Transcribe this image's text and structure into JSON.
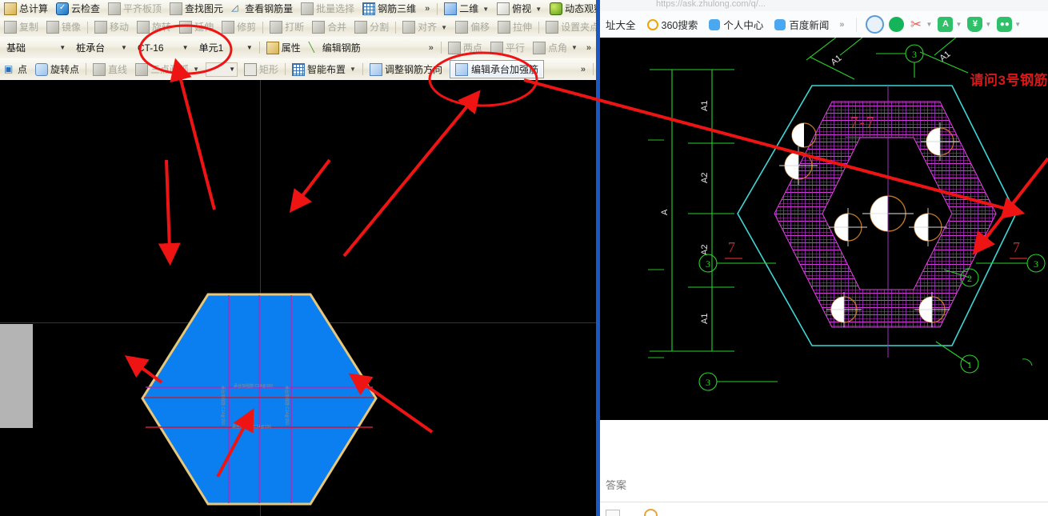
{
  "cad": {
    "toolbar_row1": [
      {
        "label": "总计算",
        "icon": "calc-icon",
        "disabled": false,
        "partial": true
      },
      {
        "label": "云检查",
        "icon": "cloud-check-icon",
        "disabled": false
      },
      {
        "label": "平齐板顶",
        "icon": "align-slab-top-icon",
        "disabled": true
      },
      {
        "label": "查找图元",
        "icon": "binoculars-icon",
        "disabled": false
      },
      {
        "label": "查看钢筋量",
        "icon": "rebar-quantity-icon",
        "disabled": false
      },
      {
        "label": "批量选择",
        "icon": "batch-select-icon",
        "disabled": true
      },
      {
        "label": "钢筋三维",
        "icon": "rebar-3d-icon",
        "disabled": false
      }
    ],
    "toolbar_row1_right": [
      {
        "label": "二维",
        "icon": "2d-view-icon",
        "caret": true
      },
      {
        "label": "俯视",
        "icon": "top-view-icon",
        "caret": true
      },
      {
        "label": "动态观察",
        "icon": "orbit-icon",
        "caret": false
      }
    ],
    "toolbar_row2": [
      {
        "label": "复制",
        "icon": "copy-icon",
        "disabled": true
      },
      {
        "label": "镜像",
        "icon": "mirror-icon",
        "disabled": true
      },
      {
        "label": "移动",
        "icon": "move-icon",
        "disabled": true
      },
      {
        "label": "旋转",
        "icon": "rotate-icon",
        "disabled": true
      },
      {
        "label": "延伸",
        "icon": "extend-icon",
        "disabled": true
      },
      {
        "label": "修剪",
        "icon": "trim-icon",
        "disabled": true
      },
      {
        "label": "打断",
        "icon": "break-icon",
        "disabled": true
      },
      {
        "label": "合并",
        "icon": "merge-icon",
        "disabled": true
      },
      {
        "label": "分割",
        "icon": "split-icon",
        "disabled": true
      },
      {
        "label": "对齐",
        "icon": "align-icon",
        "disabled": true,
        "caret": true
      },
      {
        "label": "偏移",
        "icon": "offset-icon",
        "disabled": true
      },
      {
        "label": "拉伸",
        "icon": "stretch-icon",
        "disabled": true
      },
      {
        "label": "设置夹点",
        "icon": "set-grip-icon",
        "disabled": true
      }
    ],
    "toolbar_row3": {
      "combos": [
        {
          "name": "category",
          "value": "基础"
        },
        {
          "name": "component-type",
          "value": "桩承台"
        },
        {
          "name": "component-code",
          "value": "CT-16"
        },
        {
          "name": "unit",
          "value": "单元1"
        }
      ],
      "buttons": [
        {
          "label": "属性",
          "icon": "properties-icon"
        },
        {
          "label": "编辑钢筋",
          "icon": "edit-rebar-icon"
        }
      ],
      "right_items": [
        {
          "label": "两点",
          "icon": "two-point-icon",
          "disabled": true
        },
        {
          "label": "平行",
          "icon": "parallel-icon",
          "disabled": true
        },
        {
          "label": "点角",
          "icon": "point-angle-icon",
          "disabled": true,
          "caret": true
        }
      ]
    },
    "toolbar_row4": [
      {
        "label": "点",
        "icon": "point-icon",
        "disabled": false
      },
      {
        "label": "旋转点",
        "icon": "rotate-point-icon",
        "disabled": false
      },
      {
        "label": "直线",
        "icon": "line-icon",
        "disabled": true
      },
      {
        "label": "三点画弧",
        "icon": "three-point-arc-icon",
        "disabled": true,
        "caret": true
      },
      {
        "label": "矩形",
        "icon": "rectangle-icon",
        "disabled": true
      },
      {
        "label": "智能布置",
        "icon": "smart-layout-icon",
        "disabled": false,
        "caret": true
      },
      {
        "label": "调整钢筋方向",
        "icon": "adjust-rebar-direction-icon",
        "disabled": false
      },
      {
        "label": "编辑承台加强筋",
        "icon": "edit-cap-stiffener-icon",
        "disabled": false,
        "active": true
      }
    ],
    "overflow_glyph": "»",
    "canvas": {
      "shape": "hexagon-pile-cap",
      "fill_color": "#0b7ff0",
      "outline_color": "#e8c77a",
      "grid_color": "#b32ab3",
      "axis_color": "#b00000",
      "inner_labels": [
        "承台加强筋 C14@150",
        "承台加强筋 C14@150",
        "承台加强筋 C14@150",
        "承台加强筋 C14@150"
      ]
    }
  },
  "annotations": {
    "ellipses": [
      {
        "name": "unit-combo-highlight",
        "target": "单元1"
      },
      {
        "name": "edit-cap-stiffener-highlight",
        "target": "编辑承台加强筋"
      }
    ],
    "arrow_count": 8,
    "color": "#ee1414"
  },
  "browser": {
    "address_bar_text": "https://ask.zhulong.com/q/...",
    "bookmarks": [
      {
        "label": "址大全",
        "icon": "site-directory-icon",
        "partial": true
      },
      {
        "label": "360搜索",
        "icon": "360-search-icon"
      },
      {
        "label": "个人中心",
        "icon": "baidu-paw-icon"
      },
      {
        "label": "百度新闻",
        "icon": "baidu-paw-icon"
      }
    ],
    "bookmarks_overflow": "»",
    "extensions": [
      {
        "name": "adblock-icon",
        "caret": false
      },
      {
        "name": "reader-mode-icon",
        "caret": false
      },
      {
        "name": "screenshot-scissors-icon",
        "caret": true
      },
      {
        "name": "translate-icon",
        "caret": true
      },
      {
        "name": "shopping-assistant-icon",
        "caret": true,
        "badge": true
      },
      {
        "name": "game-center-icon",
        "caret": true
      }
    ],
    "page": {
      "question_text": "请问3号钢筋",
      "section_label": "7-7",
      "answer_label": "答案",
      "drawing": {
        "dimension_labels_vertical": [
          "A1",
          "A2",
          "A",
          "A2",
          "A1"
        ],
        "dimension_labels_top": [
          "A1",
          "A1"
        ],
        "bubble_numbers": [
          "3",
          "3",
          "3",
          "3",
          "2",
          "1"
        ],
        "outline_color": "#3fd6d6",
        "rebar_color": "#e040e0",
        "dimension_color": "#27d427",
        "section_mark_color": "#cc2b2b"
      }
    }
  }
}
